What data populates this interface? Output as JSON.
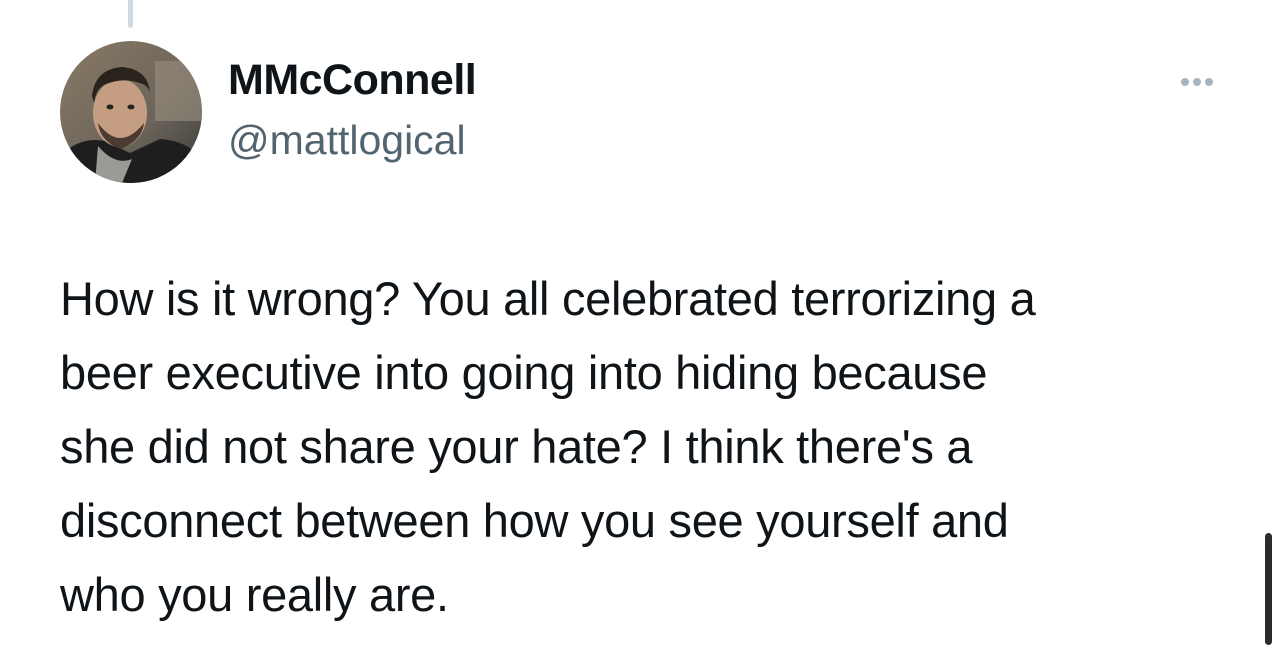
{
  "author": {
    "display_name": "MMcConnell",
    "handle": "@mattlogical",
    "avatar_icon": "user-photo-avatar"
  },
  "tweet": {
    "lines": [
      "How is it wrong? You all celebrated terrorizing a",
      "beer executive into going into hiding because",
      "she did not share your hate? I think there's a",
      "disconnect between how you see yourself and",
      "who you really are."
    ]
  },
  "icons": {
    "more": "more-horizontal-icon"
  },
  "colors": {
    "text_primary": "#0f1419",
    "text_secondary": "#536471",
    "thread_line": "#cfd9de",
    "more_icon": "#a8b4bd"
  }
}
